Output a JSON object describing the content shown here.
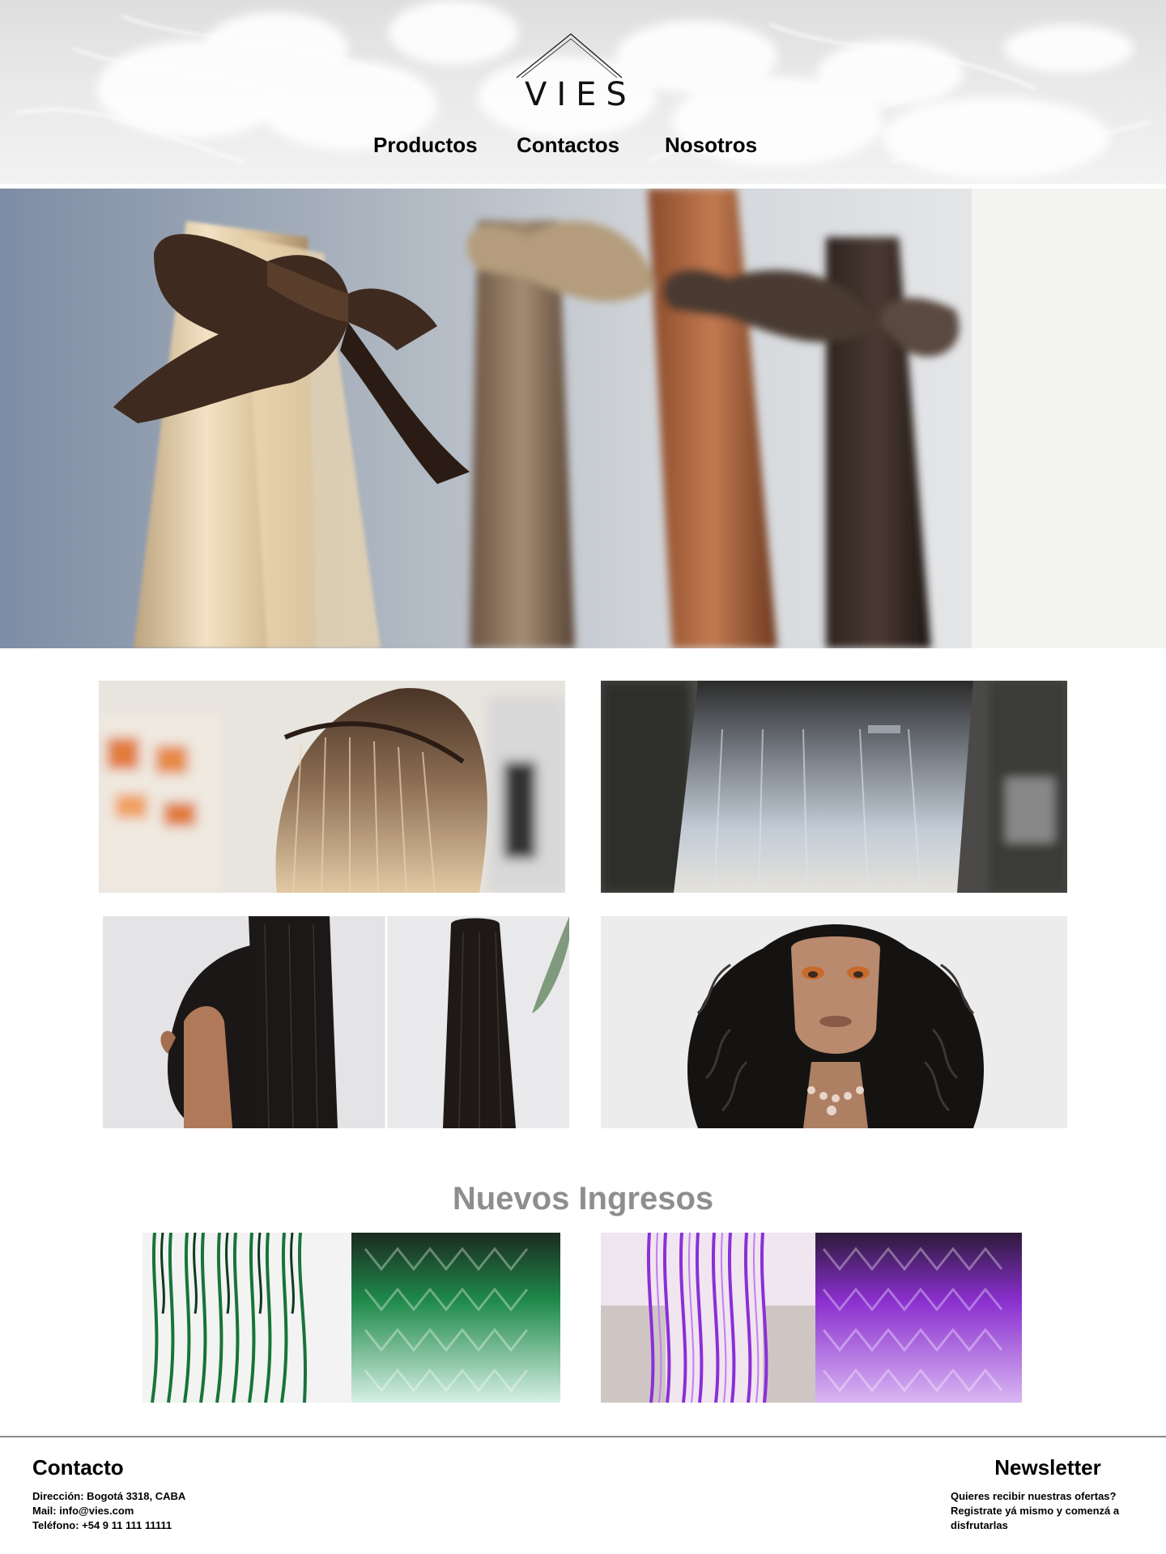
{
  "brand": {
    "name": "VIES"
  },
  "nav": {
    "items": [
      {
        "label": "Productos"
      },
      {
        "label": "Contactos"
      },
      {
        "label": "Nosotros"
      }
    ]
  },
  "hero": {
    "image": "hair-extensions-with-ribbon-bows"
  },
  "gallery": {
    "images": [
      "keratin-bond-extensions",
      "tape-in-extensions",
      "ponytail-extension",
      "wig-on-mannequin"
    ]
  },
  "new_arrivals": {
    "title": "Nuevos Ingresos",
    "images": [
      "green-ombre-braids",
      "purple-ombre-braids"
    ]
  },
  "footer": {
    "contact": {
      "title": "Contacto",
      "address": "Dirección: Bogotá 3318, CABA",
      "mail": "Mail: info@vies.com",
      "phone": "Teléfono: +54 9 11 111 11111"
    },
    "newsletter": {
      "title": "Newsletter",
      "lines": [
        "Quieres recibir nuestras ofertas?",
        "Registrate yá mismo y comenzá a",
        "disfrutarlas"
      ]
    }
  },
  "colors": {
    "section_title": "#8e8e8e",
    "footer_rule": "#8a8a8a"
  }
}
